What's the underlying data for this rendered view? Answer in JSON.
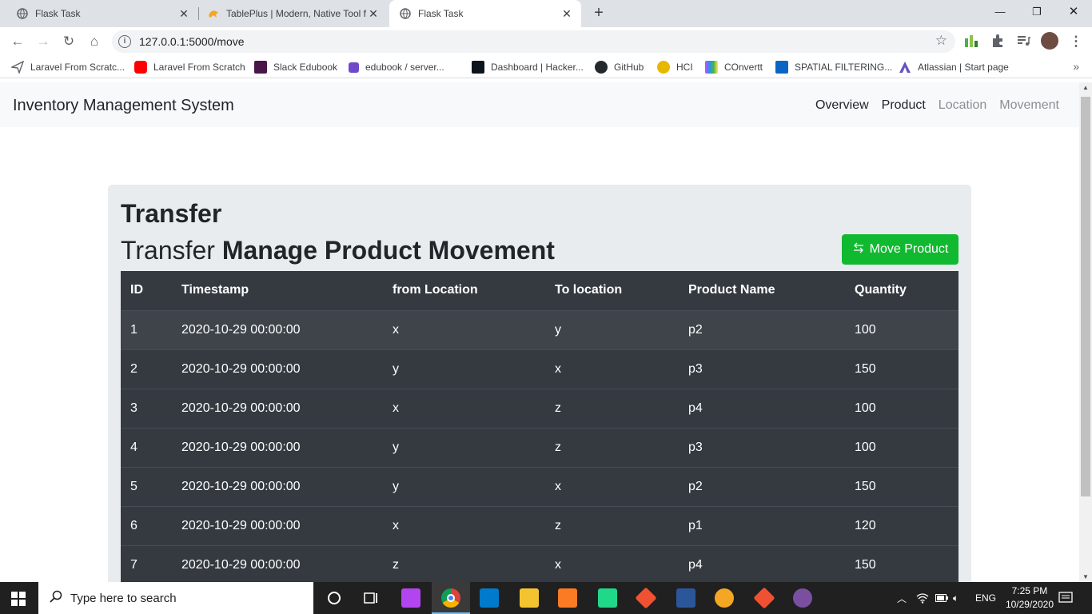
{
  "browser": {
    "tabs": [
      {
        "title": "Flask Task",
        "icon": "globe-icon",
        "active": false
      },
      {
        "title": "TablePlus | Modern, Native Tool f",
        "icon": "tableplus-icon",
        "active": false
      },
      {
        "title": "Flask Task",
        "icon": "globe-icon",
        "active": true
      }
    ],
    "new_tab": "+",
    "url": "127.0.0.1:5000/move",
    "bookmarks": [
      {
        "label": "Laravel From Scratc...",
        "icon": "paper-plane-icon",
        "color": "#5f6368"
      },
      {
        "label": "Laravel From Scratch",
        "icon": "youtube-icon",
        "color": "#ff0000"
      },
      {
        "label": "Slack Edubook",
        "icon": "slack-icon",
        "color": "#4a154b"
      },
      {
        "label": "edubook / server...",
        "icon": "gitlab-icon",
        "color": "#6e49cb"
      },
      {
        "label": "Dashboard | Hacker...",
        "icon": "hackerrank-icon",
        "color": "#0e141e"
      },
      {
        "label": "GitHub",
        "icon": "github-icon",
        "color": "#24292e"
      },
      {
        "label": "HCI",
        "icon": "coin-icon",
        "color": "#e6b800"
      },
      {
        "label": "COnvertt",
        "icon": "color-grid-icon",
        "color": "#e040fb"
      },
      {
        "label": "SPATIAL FILTERING...",
        "icon": "linkedin-icon",
        "color": "#0a66c2"
      },
      {
        "label": "Atlassian | Start page",
        "icon": "atlassian-icon",
        "color": "#6554c0"
      }
    ]
  },
  "app": {
    "brand": "Inventory Management System",
    "nav": [
      {
        "label": "Overview",
        "state": "normal"
      },
      {
        "label": "Product",
        "state": "normal"
      },
      {
        "label": "Location",
        "state": "muted"
      },
      {
        "label": "Movement",
        "state": "muted"
      }
    ]
  },
  "main": {
    "heading": "Transfer",
    "subheading_prefix": "Transfer",
    "subheading_strong": "Manage Product Movement",
    "move_button": "Move Product",
    "columns": [
      "ID",
      "Timestamp",
      "from Location",
      "To location",
      "Product Name",
      "Quantity"
    ],
    "rows": [
      [
        "1",
        "2020-10-29 00:00:00",
        "x",
        "y",
        "p2",
        "100"
      ],
      [
        "2",
        "2020-10-29 00:00:00",
        "y",
        "x",
        "p3",
        "150"
      ],
      [
        "3",
        "2020-10-29 00:00:00",
        "x",
        "z",
        "p4",
        "100"
      ],
      [
        "4",
        "2020-10-29 00:00:00",
        "y",
        "z",
        "p3",
        "100"
      ],
      [
        "5",
        "2020-10-29 00:00:00",
        "y",
        "x",
        "p2",
        "150"
      ],
      [
        "6",
        "2020-10-29 00:00:00",
        "x",
        "z",
        "p1",
        "120"
      ],
      [
        "7",
        "2020-10-29 00:00:00",
        "z",
        "x",
        "p4",
        "150"
      ]
    ]
  },
  "taskbar": {
    "search_placeholder": "Type here to search",
    "language": "ENG",
    "time": "7:25 PM",
    "date": "10/29/2020",
    "apps": [
      {
        "icon": "task-view-icon",
        "color": "#ffffff"
      },
      {
        "icon": "phpstorm-icon",
        "color": "#b345f1"
      },
      {
        "icon": "chrome-icon",
        "color": "#4caf50"
      },
      {
        "icon": "vscode-icon",
        "color": "#007acc"
      },
      {
        "icon": "file-explorer-icon",
        "color": "#f4c430"
      },
      {
        "icon": "xampp-icon",
        "color": "#fb7a24"
      },
      {
        "icon": "pycharm-icon",
        "color": "#21d789"
      },
      {
        "icon": "git-icon",
        "color": "#f05133"
      },
      {
        "icon": "word-icon",
        "color": "#2b579a"
      },
      {
        "icon": "tableplus-icon",
        "color": "#f5a623"
      },
      {
        "icon": "git-icon",
        "color": "#f05133"
      },
      {
        "icon": "github-desktop-icon",
        "color": "#7b4fa0"
      }
    ]
  }
}
